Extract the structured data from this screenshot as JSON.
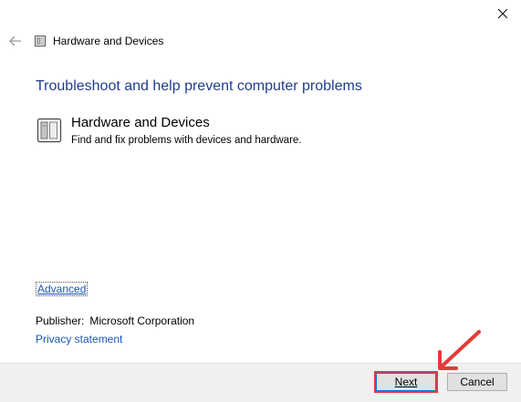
{
  "window": {
    "title": "Hardware and Devices"
  },
  "main": {
    "heading": "Troubleshoot and help prevent computer problems",
    "item": {
      "title": "Hardware and Devices",
      "description": "Find and fix problems with devices and hardware.",
      "icon": "hardware-device-icon"
    },
    "advanced_link": "Advanced",
    "publisher_label": "Publisher:",
    "publisher_value": "Microsoft Corporation",
    "privacy_link": "Privacy statement"
  },
  "footer": {
    "next_label": "Next",
    "cancel_label": "Cancel"
  },
  "colors": {
    "heading": "#1e3d8f",
    "link": "#1a56b8",
    "annotation": "#e53a3a",
    "footer_bg": "#f0f0f0"
  }
}
